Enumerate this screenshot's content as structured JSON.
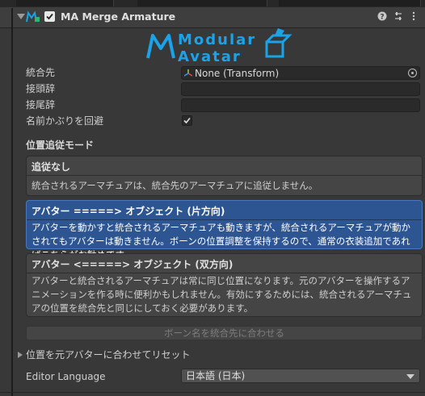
{
  "component": {
    "title": "MA Merge Armature",
    "icon": "modular-avatar-component-icon",
    "enabled": true
  },
  "header_buttons": [
    "help-icon",
    "presets-icon",
    "kebab-menu-icon"
  ],
  "logo": {
    "line1": "Modular",
    "line2": "Avatar",
    "color": "#1aa3e8"
  },
  "fields": {
    "merge_target": {
      "label": "統合先",
      "value": "None (Transform)"
    },
    "prefix": {
      "label": "接頭辞",
      "value": ""
    },
    "suffix": {
      "label": "接尾辞",
      "value": ""
    },
    "avoid_name_collisions": {
      "label": "名前かぶりを回避",
      "checked": true
    }
  },
  "position_mode": {
    "title": "位置追従モード",
    "options": [
      {
        "title": "追従なし",
        "description": "統合されるアーマチュアは、統合先のアーマチュアに追従しません。",
        "selected": false
      },
      {
        "title": "アバター =====> オブジェクト (片方向)",
        "description": "アバターを動かすと統合されるアーマチュアも動きますが、統合されるアーマチュアが動かされてもアバターは動きません。ボーンの位置調整を保持するので、通常の衣装追加であればこちらがお勧めです。",
        "selected": true
      },
      {
        "title": "アバター <=====> オブジェクト (双方向)",
        "description": "アバターと統合されるアーマチュアは常に同じ位置になります。元のアバターを操作するアニメーションを作る時に便利かもしれません。有効にするためには、統合されるアーマチュアの位置を統合先と同じにしておく必要があります。",
        "selected": false
      }
    ]
  },
  "adjust_names_button": "ボーン名を統合先に合わせる",
  "reset_foldout": "位置を元アバターに合わせてリセット",
  "language": {
    "label": "Editor Language",
    "value": "日本語 (日本)"
  },
  "colors": {
    "background": "#383838",
    "selected_option": "#2d5592",
    "logo_blue": "#1aa3e8"
  }
}
